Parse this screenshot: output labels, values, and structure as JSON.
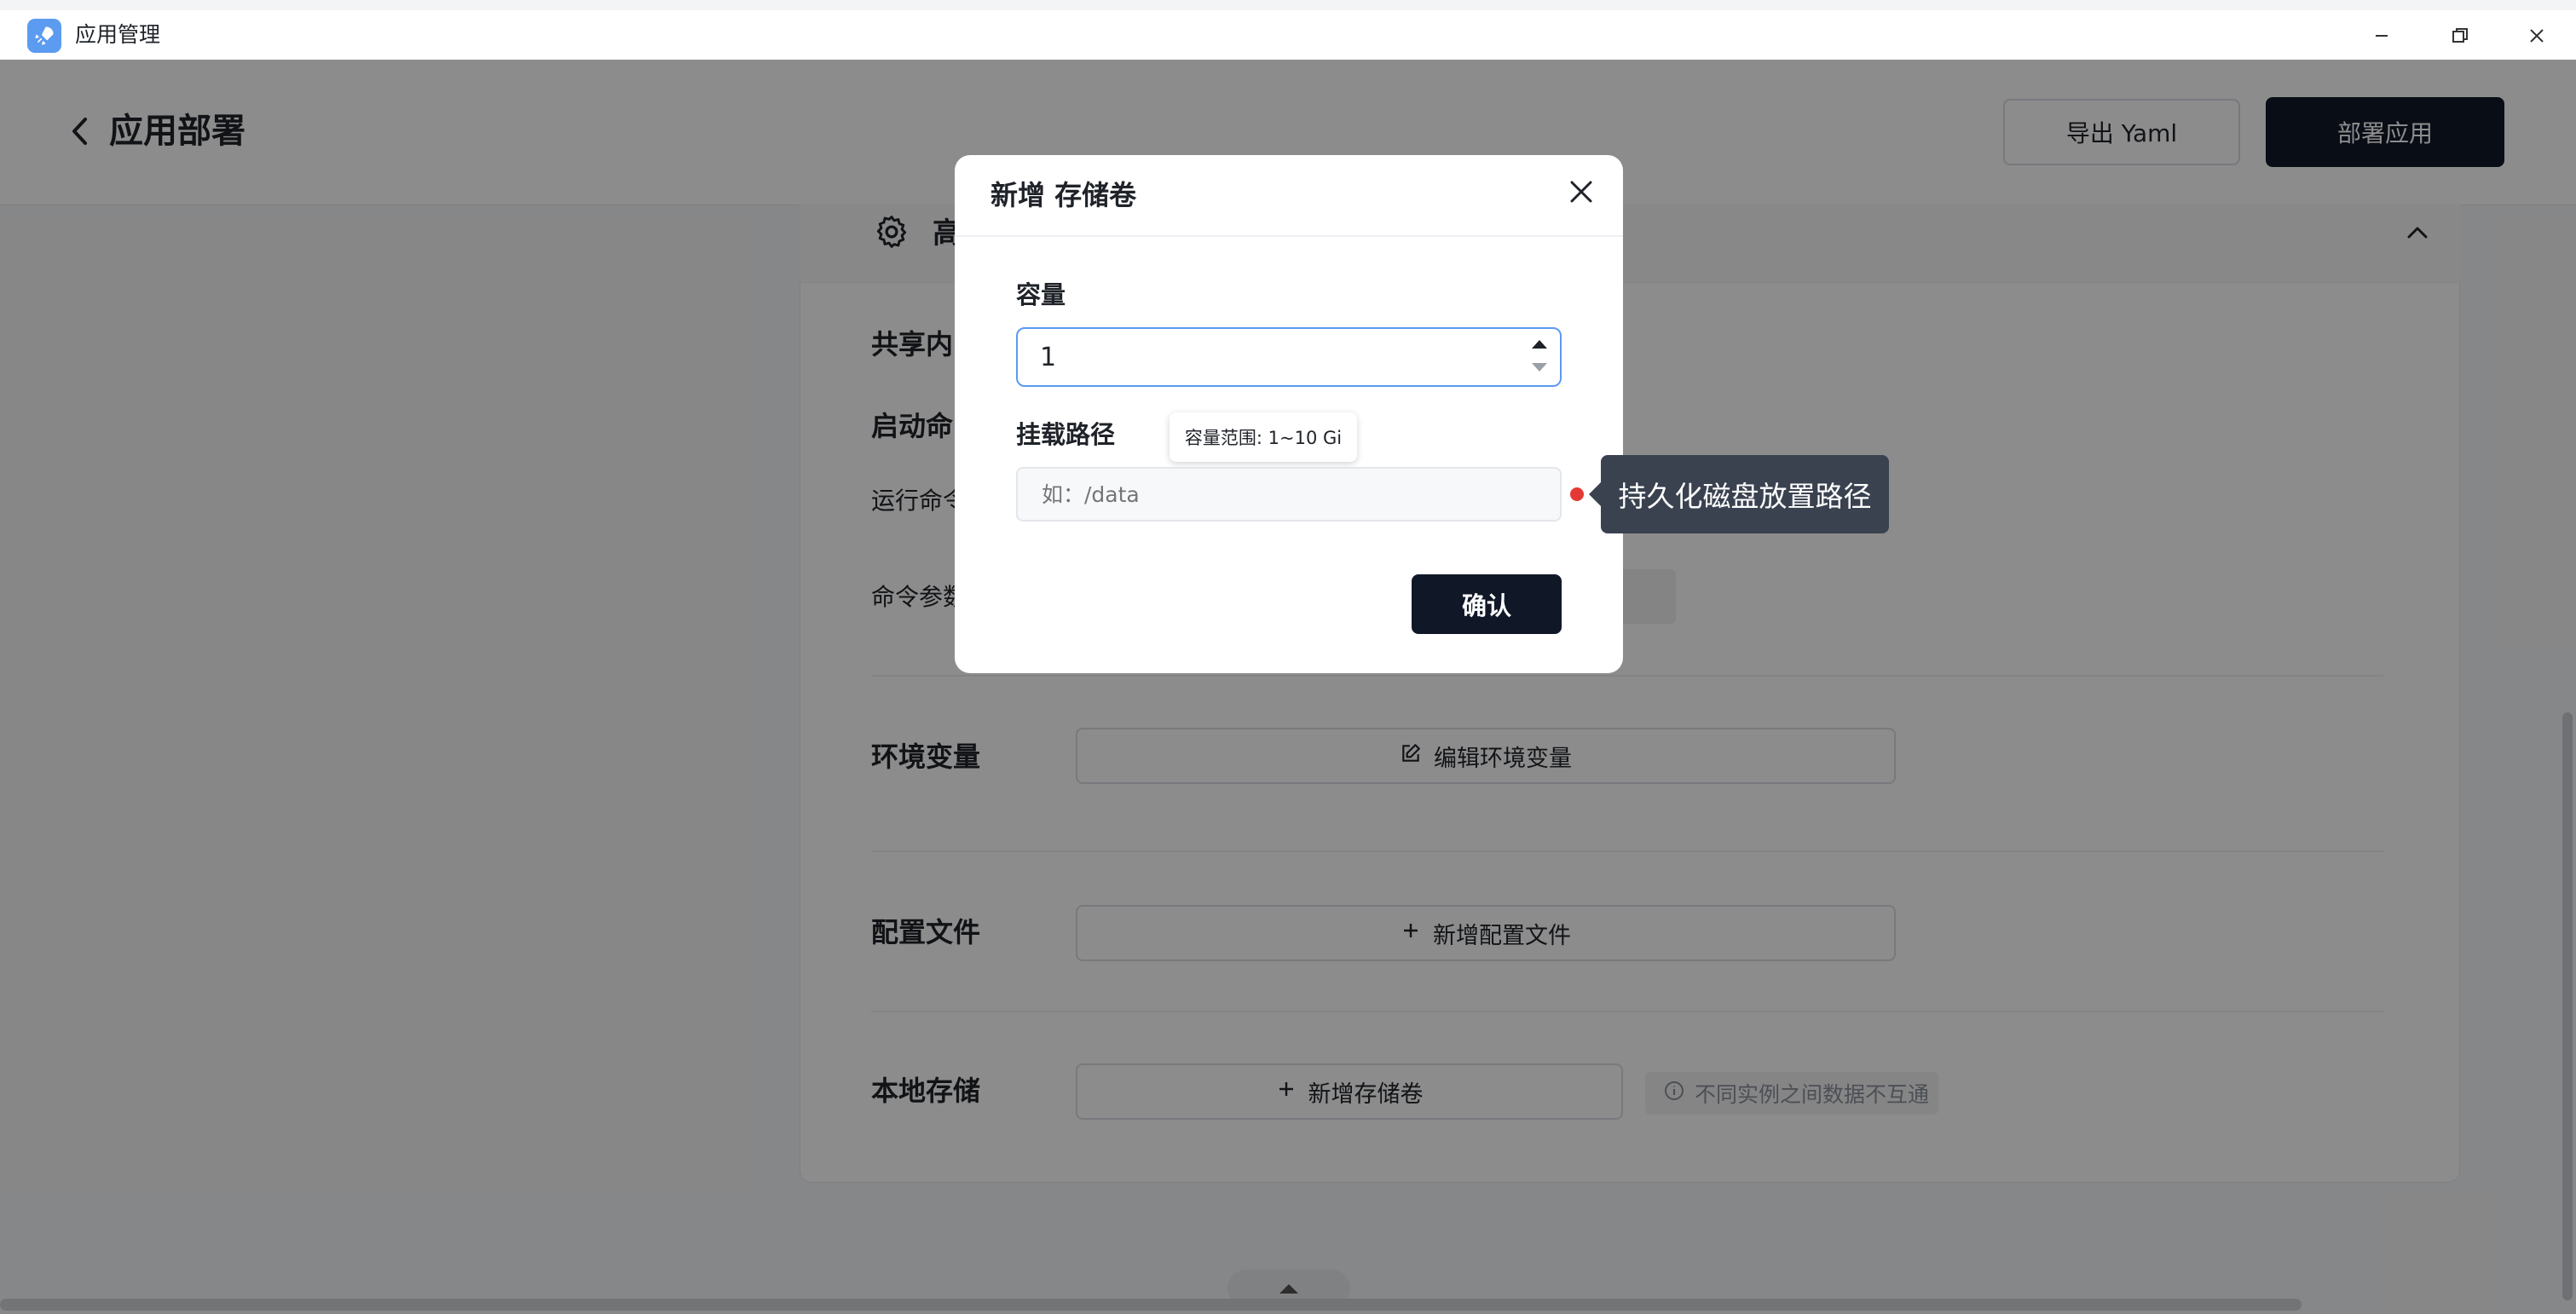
{
  "window": {
    "title": "应用管理"
  },
  "header": {
    "title": "应用部署",
    "export_label": "导出 Yaml",
    "deploy_label": "部署应用"
  },
  "section": {
    "title": "高",
    "rows": {
      "shared_memory": "共享内",
      "startup_cmd": "启动命",
      "run_cmd": "运行命令",
      "cmd_args": "命令参数",
      "env_vars": "环境变量",
      "env_button": "编辑环境变量",
      "config_files": "配置文件",
      "config_button": "新增配置文件",
      "local_storage": "本地存储",
      "storage_button": "新增存储卷",
      "storage_hint": "不同实例之间数据不互通"
    }
  },
  "modal": {
    "title": "新增 存储卷",
    "capacity_label": "容量",
    "capacity_value": "1",
    "capacity_tooltip": "容量范围: 1~10 Gi",
    "path_label": "挂载路径",
    "path_placeholder": "如：/data",
    "path_tooltip": "持久化磁盘放置路径",
    "confirm_label": "确认"
  },
  "colors": {
    "primary_dark": "#101828",
    "focus_blue": "#5b9bf0",
    "required_red": "#e53935",
    "tooltip_dark": "#3a4250"
  }
}
